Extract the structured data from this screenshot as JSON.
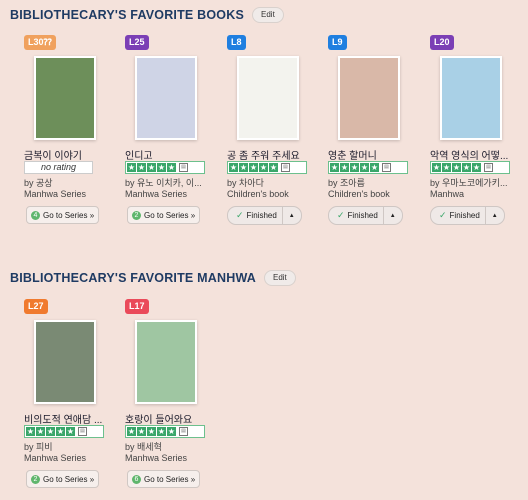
{
  "sections": [
    {
      "title": "BIBLIOTHECARY'S FAVORITE BOOKS",
      "edit_label": "Edit",
      "books": [
        {
          "level": "L30⁇",
          "level_color": "#f0a15e",
          "title": "금복이 이야기",
          "rating": "no rating",
          "author": "by 공상",
          "series": "Manhwa Series",
          "action": "series",
          "series_count": "4",
          "action_label": "Go to Series »",
          "cover_color": "#6d8f5a"
        },
        {
          "level": "L25",
          "level_color": "#7b3fb5",
          "title": "인디고",
          "rating": "stars",
          "author": "by 유노 이치카, 이...",
          "series": "Manhwa Series",
          "action": "series",
          "series_count": "2",
          "action_label": "Go to Series »",
          "cover_color": "#cfd4e6"
        },
        {
          "level": "L8",
          "level_color": "#1f7fe0",
          "title": "공 좀 주워 주세요",
          "rating": "stars",
          "author": "by 차아다",
          "series": "Children's book",
          "action": "finished",
          "action_label": "Finished",
          "cover_color": "#f3f3ee"
        },
        {
          "level": "L9",
          "level_color": "#1f7fe0",
          "title": "영춘 할머니",
          "rating": "stars",
          "author": "by 조아름",
          "series": "Children's book",
          "action": "finished",
          "action_label": "Finished",
          "cover_color": "#d9b8a8"
        },
        {
          "level": "L20",
          "level_color": "#7b3fb5",
          "title": "악역 영식의 어떻...",
          "rating": "stars",
          "author": "by 우마노코에가키...",
          "series": "Manhwa",
          "action": "finished",
          "action_label": "Finished",
          "cover_color": "#a9d0e6"
        }
      ]
    },
    {
      "title": "BIBLIOTHECARY'S FAVORITE MANHWA",
      "edit_label": "Edit",
      "books": [
        {
          "level": "L27",
          "level_color": "#f07a2e",
          "title": "비의도적 연애담 ...",
          "rating": "stars",
          "author": "by 피비",
          "series": "Manhwa Series",
          "action": "series",
          "series_count": "2",
          "action_label": "Go to Series »",
          "cover_color": "#7a8a74"
        },
        {
          "level": "L17",
          "level_color": "#ea4a5a",
          "title": "호랑이 들어와요",
          "rating": "stars",
          "author": "by 배세혁",
          "series": "Manhwa Series",
          "action": "series",
          "series_count": "6",
          "action_label": "Go to Series »",
          "cover_color": "#9fc6a2"
        }
      ]
    }
  ]
}
